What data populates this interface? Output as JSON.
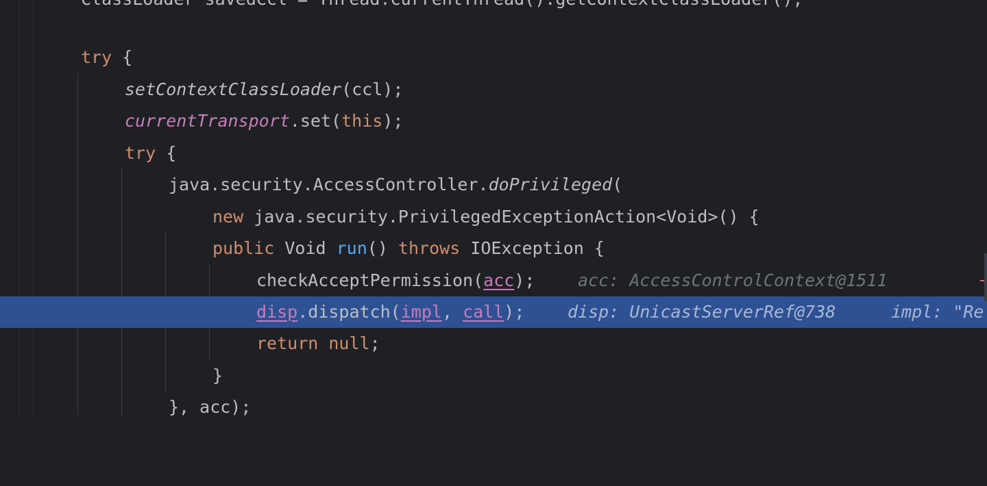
{
  "editor": {
    "lines": [
      {
        "id": "l0",
        "parts": [
          {
            "t": "ClassLoader savedCcl = Thread.currentThread().getContextClassLoader();",
            "c": ""
          }
        ]
      },
      {
        "id": "l2",
        "parts": [
          {
            "t": "try",
            "c": "kw"
          },
          {
            "t": " {",
            "c": ""
          }
        ]
      },
      {
        "id": "l3",
        "parts": [
          {
            "t": "setContextClassLoader",
            "c": "fn-it"
          },
          {
            "t": "(ccl);",
            "c": ""
          }
        ]
      },
      {
        "id": "l4",
        "parts": [
          {
            "t": "currentTransport",
            "c": "fld"
          },
          {
            "t": ".set(",
            "c": ""
          },
          {
            "t": "this",
            "c": "kw"
          },
          {
            "t": ");",
            "c": ""
          }
        ]
      },
      {
        "id": "l5",
        "parts": [
          {
            "t": "try",
            "c": "kw"
          },
          {
            "t": " {",
            "c": ""
          }
        ]
      },
      {
        "id": "l6",
        "parts": [
          {
            "t": "java.security.AccessController.",
            "c": ""
          },
          {
            "t": "doPrivileged",
            "c": "fn-it"
          },
          {
            "t": "(",
            "c": ""
          }
        ]
      },
      {
        "id": "l7",
        "parts": [
          {
            "t": "new",
            "c": "kw"
          },
          {
            "t": " java.security.PrivilegedExceptionAction<Void>() {",
            "c": ""
          }
        ]
      },
      {
        "id": "l8",
        "parts": [
          {
            "t": "public",
            "c": "kw"
          },
          {
            "t": " Void ",
            "c": ""
          },
          {
            "t": "run",
            "c": "fnd"
          },
          {
            "t": "() ",
            "c": ""
          },
          {
            "t": "throws",
            "c": "kw"
          },
          {
            "t": " IOException {",
            "c": ""
          }
        ]
      },
      {
        "id": "l9",
        "parts": [
          {
            "t": "checkAcceptPermission(",
            "c": ""
          },
          {
            "t": "acc",
            "c": "var"
          },
          {
            "t": ");",
            "c": ""
          }
        ],
        "hint": "acc: AccessControlContext@1511"
      },
      {
        "id": "l10",
        "parts": [
          {
            "t": "disp",
            "c": "var"
          },
          {
            "t": ".dispatch(",
            "c": ""
          },
          {
            "t": "impl",
            "c": "var"
          },
          {
            "t": ", ",
            "c": ""
          },
          {
            "t": "call",
            "c": "var"
          },
          {
            "t": ");",
            "c": ""
          }
        ],
        "hint": "disp: UnicastServerRef@738",
        "hint2": "impl: \"Re"
      },
      {
        "id": "l11",
        "parts": [
          {
            "t": "return",
            "c": "kw"
          },
          {
            "t": " ",
            "c": ""
          },
          {
            "t": "null",
            "c": "kw"
          },
          {
            "t": ";",
            "c": ""
          }
        ]
      },
      {
        "id": "l12",
        "parts": [
          {
            "t": "}",
            "c": ""
          }
        ]
      },
      {
        "id": "l13",
        "parts": [
          {
            "t": "}, acc);",
            "c": ""
          }
        ]
      }
    ]
  }
}
